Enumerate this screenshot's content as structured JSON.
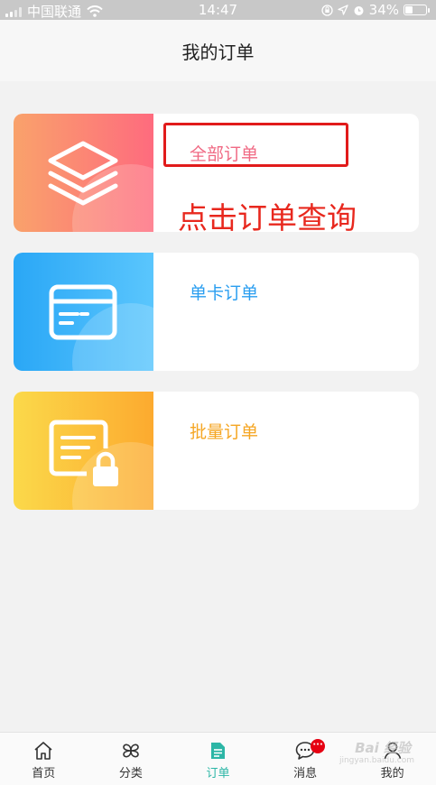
{
  "status_bar": {
    "carrier": "中国联通",
    "time": "14:47",
    "battery": "34%",
    "battery_level": 0.34,
    "icons": [
      "signal-icon",
      "wifi-icon",
      "lock-rotation-icon",
      "location-icon",
      "alarm-icon",
      "battery-icon"
    ]
  },
  "nav": {
    "title": "我的订单"
  },
  "cards": [
    {
      "label": "全部订单",
      "icon": "layers-icon",
      "gradient": [
        "#f9a26b",
        "#fe6b7e"
      ],
      "label_color": "#f06a84"
    },
    {
      "label": "单卡订单",
      "icon": "card-icon",
      "gradient": [
        "#2aa7f6",
        "#5ac6fd"
      ],
      "label_color": "#2a9ef0"
    },
    {
      "label": "批量订单",
      "icon": "locked-document-icon",
      "gradient": [
        "#fbd94a",
        "#fcaa2f"
      ],
      "label_color": "#f5a623"
    }
  ],
  "annotation": {
    "text": "点击订单查询",
    "color": "#e8281e"
  },
  "tabs": [
    {
      "label": "首页",
      "icon": "home-icon",
      "active": false
    },
    {
      "label": "分类",
      "icon": "category-icon",
      "active": false
    },
    {
      "label": "订单",
      "icon": "order-icon",
      "active": true
    },
    {
      "label": "消息",
      "icon": "message-icon",
      "active": false,
      "badge": "···"
    },
    {
      "label": "我的",
      "icon": "user-icon",
      "active": false
    }
  ],
  "accent_color": "#2cb6a6",
  "watermark": {
    "text": "Bai 经验",
    "sub": "jingyan.baidu.com"
  }
}
